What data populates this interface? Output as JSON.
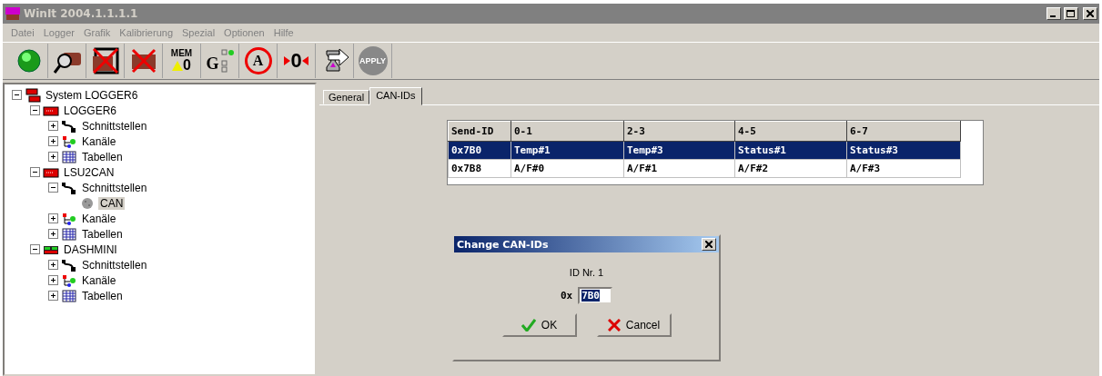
{
  "window": {
    "title": "WinIt 2004.1.1.1.1",
    "active": false
  },
  "menu": [
    "Datei",
    "Logger",
    "Grafik",
    "Kalibrierung",
    "Spezial",
    "Optionen",
    "Hilfe"
  ],
  "toolbar": [
    {
      "kind": "led"
    },
    {
      "kind": "search"
    },
    {
      "kind": "remove-frame"
    },
    {
      "kind": "remove"
    },
    {
      "kind": "mem",
      "label": "MEM",
      "value": "0"
    },
    {
      "kind": "channels",
      "label": "G"
    },
    {
      "kind": "auto",
      "label": "A"
    },
    {
      "kind": "zero",
      "label": "0"
    },
    {
      "kind": "transfer"
    },
    {
      "kind": "apply",
      "label": "APPLY"
    }
  ],
  "tree": [
    {
      "label": "System LOGGER6",
      "kind": "system",
      "expanded": true,
      "selected": false,
      "children": [
        {
          "label": "LOGGER6",
          "kind": "device",
          "expanded": true,
          "selected": false,
          "children": [
            {
              "label": "Schnittstellen",
              "kind": "cable",
              "expanded": false,
              "selected": false
            },
            {
              "label": "Kanäle",
              "kind": "channels",
              "expanded": false,
              "selected": false
            },
            {
              "label": "Tabellen",
              "kind": "table",
              "expanded": false,
              "selected": false
            }
          ]
        },
        {
          "label": "LSU2CAN",
          "kind": "device",
          "expanded": true,
          "selected": false,
          "children": [
            {
              "label": "Schnittstellen",
              "kind": "cable",
              "expanded": true,
              "selected": false,
              "children": [
                {
                  "label": "CAN",
                  "kind": "port",
                  "selected": true
                }
              ]
            },
            {
              "label": "Kanäle",
              "kind": "channels",
              "expanded": false,
              "selected": false
            },
            {
              "label": "Tabellen",
              "kind": "table",
              "expanded": false,
              "selected": false
            }
          ]
        },
        {
          "label": "DASHMINI",
          "kind": "dash",
          "expanded": true,
          "selected": false,
          "children": [
            {
              "label": "Schnittstellen",
              "kind": "cable",
              "expanded": false,
              "selected": false
            },
            {
              "label": "Kanäle",
              "kind": "channels",
              "expanded": false,
              "selected": false
            },
            {
              "label": "Tabellen",
              "kind": "table",
              "expanded": false,
              "selected": false
            }
          ]
        }
      ]
    }
  ],
  "tabs": [
    {
      "label": "General",
      "selected": false
    },
    {
      "label": "CAN-IDs",
      "selected": true
    }
  ],
  "table": {
    "columns": [
      "Send-ID",
      "0-1",
      "2-3",
      "4-5",
      "6-7"
    ],
    "rows": [
      {
        "cells": [
          "0x7B0",
          "Temp#1",
          "Temp#3",
          "Status#1",
          "Status#3"
        ],
        "selected": true
      },
      {
        "cells": [
          "0x7B8",
          "A/F#0",
          "A/F#1",
          "A/F#2",
          "A/F#3"
        ],
        "selected": false
      }
    ]
  },
  "dialog": {
    "title": "Change CAN-IDs",
    "caption": "ID Nr. 1",
    "prefix": "0x",
    "value": "7B0",
    "buttons": [
      {
        "kind": "ok",
        "label": "OK"
      },
      {
        "kind": "cancel",
        "label": "Cancel"
      }
    ]
  }
}
